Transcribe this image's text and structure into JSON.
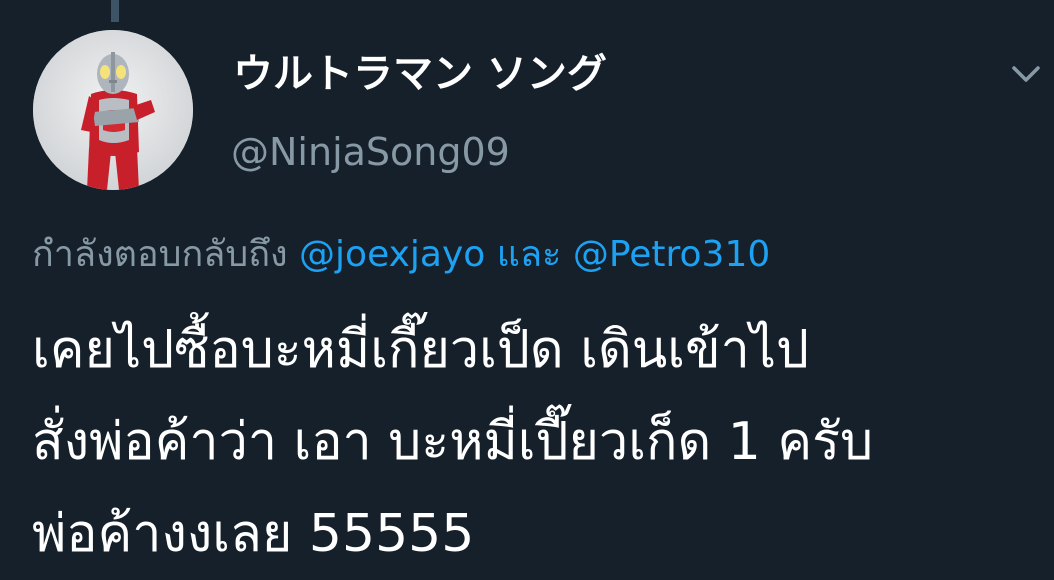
{
  "author": {
    "display_name": "ウルトラマン ソング",
    "handle": "@NinjaSong09",
    "avatar_icon": "ultraman-figure-avatar"
  },
  "menu_icon": "chevron-down-icon",
  "reply": {
    "prefix": "กำลังตอบกลับถึง",
    "mentions": [
      "@joexjayo",
      "@Petro310"
    ],
    "conjunction": "และ"
  },
  "tweet": {
    "lines": [
      "เคยไปซื้อบะหมี่เกี๊ยวเป็ด เดินเข้าไป",
      "สั่งพ่อค้าว่า เอา บะหมี่เปี๊ยวเก็ด 1 ครับ",
      "พ่อค้างงเลย 55555"
    ]
  },
  "colors": {
    "background": "#15202b",
    "text_primary": "#ffffff",
    "text_secondary": "#8899a6",
    "accent": "#1da1f2"
  }
}
